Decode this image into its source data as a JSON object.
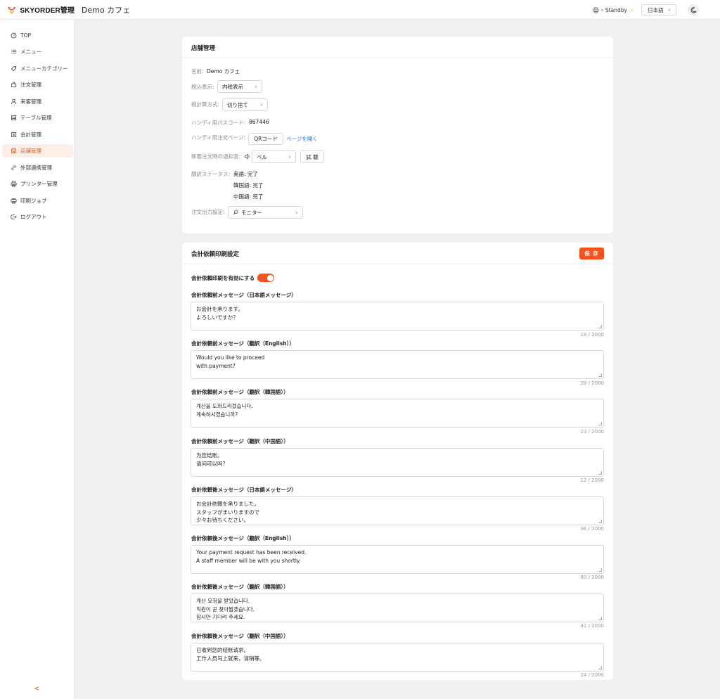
{
  "header": {
    "brand": "SKYORDER管理",
    "shop_name": "Demo カフェ",
    "printer_status": "Standby",
    "language": "日本語"
  },
  "sidebar": {
    "items": [
      {
        "label": "TOP",
        "icon": "gauge-icon"
      },
      {
        "label": "メニュー",
        "icon": "list-icon"
      },
      {
        "label": "メニューカテゴリー",
        "icon": "tag-icon"
      },
      {
        "label": "注文管理",
        "icon": "bag-icon"
      },
      {
        "label": "来客管理",
        "icon": "user-icon"
      },
      {
        "label": "テーブル管理",
        "icon": "table-icon"
      },
      {
        "label": "会計管理",
        "icon": "receipt-icon"
      },
      {
        "label": "店舗管理",
        "icon": "store-icon",
        "active": true
      },
      {
        "label": "外部連携管理",
        "icon": "link-icon"
      },
      {
        "label": "プリンター管理",
        "icon": "printer-icon"
      },
      {
        "label": "印刷ジョブ",
        "icon": "print-job-icon"
      },
      {
        "label": "ログアウト",
        "icon": "logout-icon"
      }
    ],
    "collapse_label": "<"
  },
  "store": {
    "title": "店舗管理",
    "name_label": "名前:",
    "name_value": "Demo カフェ",
    "tax_display_label": "税込表示:",
    "tax_display_value": "内税表示",
    "tax_calc_label": "税計算方式:",
    "tax_calc_value": "切り捨て",
    "handy_passcode_label": "ハンディ用パスコード:",
    "handy_passcode_value": "867446",
    "handy_order_page_label": "ハンディ用注文ページ:",
    "qr_button": "QRコード",
    "open_page_link": "ページを開く",
    "notify_sound_label": "新着注文時の通知音:",
    "notify_sound_value": "ベル",
    "listen_button": "試 聴",
    "translation_status_label": "翻訳ステータス:",
    "translation_status": [
      "英語: 完了",
      "韓国語: 完了",
      "中国語: 完了"
    ],
    "order_output_label": "注文出力設定:",
    "order_output_value": "モニター"
  },
  "billing": {
    "title": "会計依頼印刷設定",
    "save_button": "保 存",
    "toggle_label": "会計依頼印刷を有効にする",
    "toggle_on": true,
    "messages": [
      {
        "label": "会計依頼前メッセージ（日本語メッセージ）",
        "text": "お会計を承ります。\nよろしいですか？",
        "count": "18 / 2000"
      },
      {
        "label": "会計依頼前メッセージ（翻訳（English））",
        "text": "Would you like to proceed\nwith payment?",
        "count": "39 / 2000"
      },
      {
        "label": "会計依頼前メッセージ（翻訳（韓国語））",
        "text": "계산을 도와드리겠습니다.\n계속하시겠습니까?",
        "count": "23 / 2000"
      },
      {
        "label": "会計依頼前メッセージ（翻訳（中国語））",
        "text": "为您结账。\n请问可以吗？",
        "count": "12 / 2000"
      },
      {
        "label": "会計依頼後メッセージ（日本語メッセージ）",
        "text": "お会計依頼を承りました。\nスタッフがまいりますので\n少々お待ちください。",
        "count": "36 / 2000"
      },
      {
        "label": "会計依頼後メッセージ（翻訳（English））",
        "text": "Your payment request has been received.\nA staff member will be with you shortly.",
        "count": "80 / 2000"
      },
      {
        "label": "会計依頼後メッセージ（翻訳（韓国語））",
        "text": "계산 요청을 받았습니다.\n직원이 곧 찾아뵙겠습니다.\n잠시만 기다려 주세요.",
        "count": "41 / 2000"
      },
      {
        "label": "会計依頼後メッセージ（翻訳（中国語））",
        "text": "已收到您的结账请求。\n工作人员马上就来，请稍等。",
        "count": "24 / 2000"
      }
    ]
  },
  "colors": {
    "accent": "#f4511e",
    "active_bg": "#fdeee6",
    "link": "#1677ff"
  }
}
